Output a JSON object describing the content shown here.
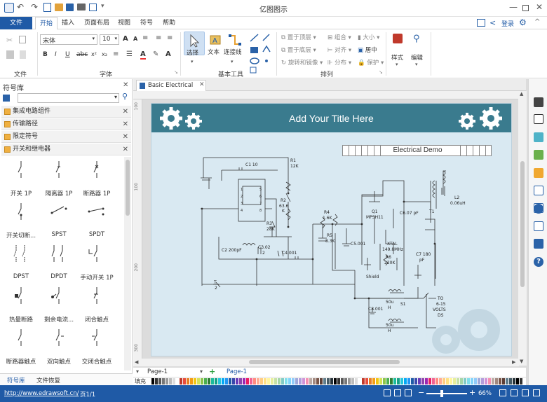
{
  "app": {
    "title": "亿图图示"
  },
  "tabs": [
    {
      "label": "文件"
    },
    {
      "label": "开始"
    },
    {
      "label": "插入"
    },
    {
      "label": "页面布局"
    },
    {
      "label": "视图"
    },
    {
      "label": "符号"
    },
    {
      "label": "帮助"
    }
  ],
  "header_right": {
    "login": "登录"
  },
  "ribbon": {
    "font_name": "宋体",
    "font_size": "10",
    "tools": {
      "select": "选择",
      "text": "文本",
      "connector": "连接线"
    },
    "arrange": {
      "bring_front": "置于顶层",
      "send_back": "置于底层",
      "rotate": "旋转和镜像",
      "group": "组合",
      "align": "对齐",
      "distribute": "分布",
      "size": "大小",
      "center": "居中",
      "protect": "保护"
    },
    "style": "样式",
    "edit": "编辑",
    "groups": {
      "file": "文件",
      "font": "字体",
      "basic_tools": "基本工具",
      "arrange": "排列"
    }
  },
  "library": {
    "title": "符号库",
    "categories": [
      "集成电路组件",
      "传输路径",
      "限定符号",
      "开关和继电器"
    ],
    "symbols": [
      "开关 1P",
      "隔离器 1P",
      "断路器 1P",
      "开关切断...",
      "SPST",
      "SPDT",
      "DPST",
      "DPDT",
      "手动开关 1P",
      "热量断路",
      "剩余电流...",
      "闭合触点",
      "断路器触点",
      "双向触点",
      "交闭合触点"
    ],
    "bottom_tabs": [
      "符号库",
      "文件恢复"
    ]
  },
  "document": {
    "tab_label": "Basic Electrical",
    "title": "Add Your Title Here",
    "demo_label": "Electrical Demo",
    "labels": {
      "c1": "C1 10",
      "r1a": "R1",
      "r1b": "12K",
      "r2a": "R2",
      "r2b": "63.6",
      "r2c": "K",
      "r3a": "R3",
      "r3b": "28K",
      "c2": "C2 200pF",
      "c3a": "C3.02",
      "c3b": "2",
      "c4": "C4.001",
      "t2a": "T",
      "t2b": "2",
      "r4a": "R4",
      "r4b": "1.6K",
      "r5a": "R5",
      "r5b": "8.3K",
      "c5": "C5.001",
      "q1a": "Q1",
      "q1b": "MPSH11",
      "c6": "C6.07 pF",
      "xtal1": "XTAL",
      "xtal2": "149.8MHz",
      "r6a": "R6",
      "r6b": "220K",
      "c7a": "C7 180",
      "c7b": "pF",
      "t1": "T1",
      "l2a": "L2",
      "l2b": "0.06uH",
      "shield": "Shield",
      "l3a": "50u",
      "l3b": "H",
      "l4a": "50u",
      "l4b": "H",
      "c8": "C8.001",
      "s1": "S1",
      "to1": "TO",
      "to2": "6-15",
      "to3": "VOLTS",
      "to4": "DS"
    }
  },
  "ruler_left": [
    "100",
    "",
    "",
    "",
    "",
    "100",
    "",
    "",
    "",
    "",
    "200",
    "",
    "",
    "",
    "",
    "300"
  ],
  "page_tabs": {
    "current": "Page-1",
    "active": "Page-1"
  },
  "fill_label": "填充",
  "status": {
    "url": "http://www.edrawsoft.cn/",
    "page": "页1/1",
    "zoom": "66%"
  },
  "colors": {
    "brand": "#1f5aa6",
    "banner": "#3a7b8e",
    "canvas_bg": "#d9e9f2"
  }
}
